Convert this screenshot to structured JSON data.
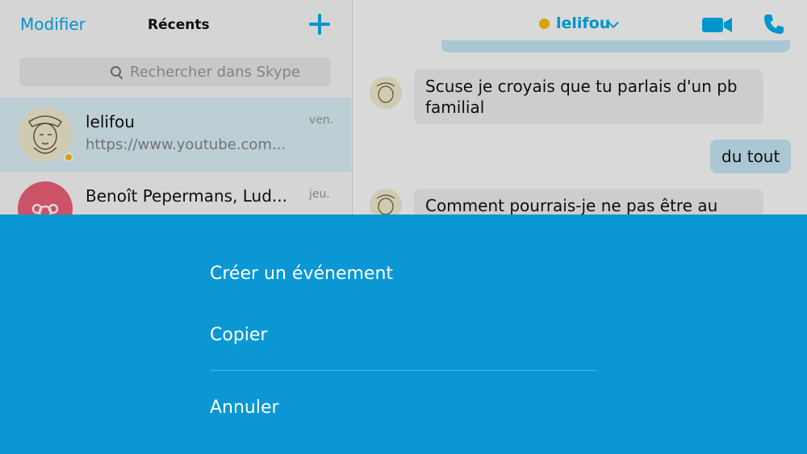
{
  "header": {
    "edit_label": "Modifier",
    "title": "Récents"
  },
  "search": {
    "placeholder": "Rechercher dans Skype"
  },
  "conversations": [
    {
      "name": "lelifou",
      "preview": "https://www.youtube.com...",
      "date": "ven.",
      "status_color": "#ffc000",
      "selected": true
    },
    {
      "name": "Benoît Pepermans, Lud...",
      "preview": "",
      "date": "jeu.",
      "avatar_color": "#f0617a"
    }
  ],
  "chat": {
    "contact_name": "lelifou",
    "status_color": "#ffc000",
    "messages": [
      {
        "direction": "in",
        "text": "Scuse je croyais que tu parlais d'un pb familial"
      },
      {
        "direction": "out",
        "text": "du tout"
      },
      {
        "direction": "in",
        "text": "Comment pourrais-je ne pas être au"
      }
    ]
  },
  "action_sheet": {
    "create_event": "Créer un événement",
    "copy": "Copier",
    "cancel": "Annuler"
  },
  "colors": {
    "accent": "#00aff0",
    "sheet_background": "#0b97d3",
    "incoming_bubble": "#f1f1f1",
    "outgoing_bubble": "#c8ebfa"
  }
}
